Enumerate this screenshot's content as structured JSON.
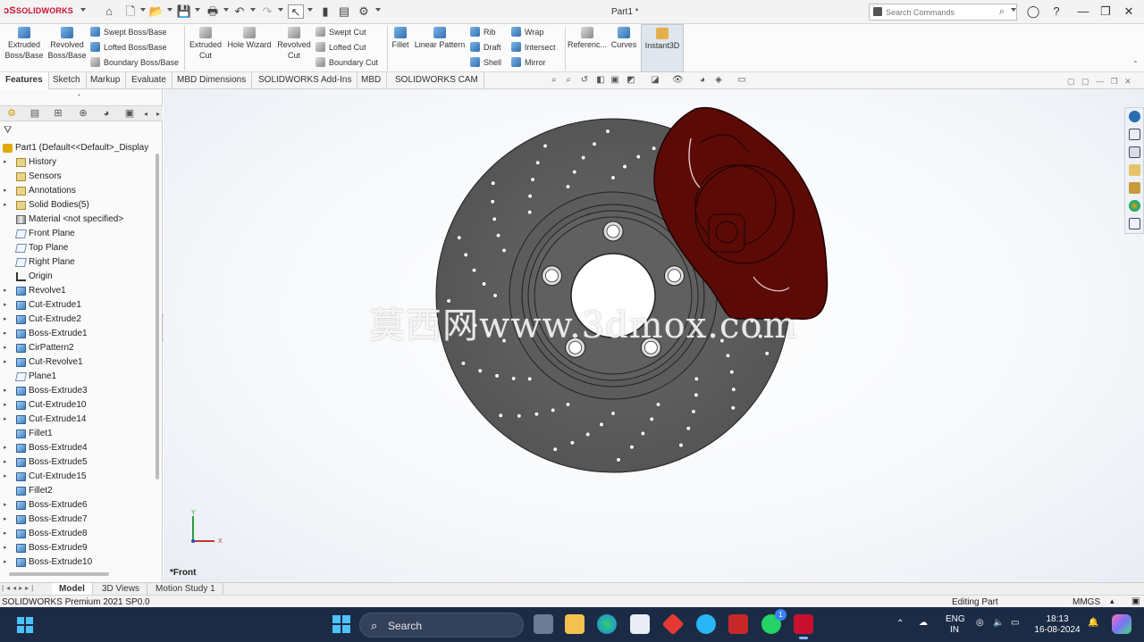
{
  "app": {
    "logo_text": "SOLIDWORKS",
    "document_title": "Part1 *",
    "search_placeholder": "Search Commands"
  },
  "ribbon": {
    "extruded_boss": "Extruded Boss/Base",
    "revolved_boss": "Revolved Boss/Base",
    "swept_boss": "Swept Boss/Base",
    "lofted_boss": "Lofted Boss/Base",
    "boundary_boss": "Boundary Boss/Base",
    "extruded_cut": "Extruded Cut",
    "hole_wizard": "Hole Wizard",
    "revolved_cut": "Revolved Cut",
    "swept_cut": "Swept Cut",
    "lofted_cut": "Lofted Cut",
    "boundary_cut": "Boundary Cut",
    "fillet": "Fillet",
    "linear_pattern": "Linear Pattern",
    "rib": "Rib",
    "draft": "Draft",
    "shell": "Shell",
    "wrap": "Wrap",
    "intersect": "Intersect",
    "mirror": "Mirror",
    "reference": "Referenc...",
    "curves": "Curves",
    "instant3d": "Instant3D"
  },
  "tabs": [
    "Features",
    "Sketch",
    "Markup",
    "Evaluate",
    "MBD Dimensions",
    "SOLIDWORKS Add-Ins",
    "MBD",
    "SOLIDWORKS CAM"
  ],
  "tree": {
    "root": "Part1  (Default<<Default>_Display",
    "items": [
      {
        "label": "History",
        "icon": "folder",
        "expand": true
      },
      {
        "label": "Sensors",
        "icon": "folder",
        "expand": false
      },
      {
        "label": "Annotations",
        "icon": "folder",
        "expand": true
      },
      {
        "label": "Solid Bodies(5)",
        "icon": "folder",
        "expand": true
      },
      {
        "label": "Material <not specified>",
        "icon": "material",
        "expand": false
      },
      {
        "label": "Front Plane",
        "icon": "plane",
        "expand": false
      },
      {
        "label": "Top Plane",
        "icon": "plane",
        "expand": false
      },
      {
        "label": "Right Plane",
        "icon": "plane",
        "expand": false
      },
      {
        "label": "Origin",
        "icon": "origin",
        "expand": false
      },
      {
        "label": "Revolve1",
        "icon": "feature",
        "expand": true
      },
      {
        "label": "Cut-Extrude1",
        "icon": "feature",
        "expand": true
      },
      {
        "label": "Cut-Extrude2",
        "icon": "feature",
        "expand": true
      },
      {
        "label": "Boss-Extrude1",
        "icon": "feature",
        "expand": true
      },
      {
        "label": "CirPattern2",
        "icon": "pattern",
        "expand": true
      },
      {
        "label": "Cut-Revolve1",
        "icon": "feature",
        "expand": true
      },
      {
        "label": "Plane1",
        "icon": "plane",
        "expand": false
      },
      {
        "label": "Boss-Extrude3",
        "icon": "feature",
        "expand": true
      },
      {
        "label": "Cut-Extrude10",
        "icon": "feature",
        "expand": true
      },
      {
        "label": "Cut-Extrude14",
        "icon": "feature",
        "expand": true
      },
      {
        "label": "Fillet1",
        "icon": "feature",
        "expand": false
      },
      {
        "label": "Boss-Extrude4",
        "icon": "feature",
        "expand": true
      },
      {
        "label": "Boss-Extrude5",
        "icon": "feature",
        "expand": true
      },
      {
        "label": "Cut-Extrude15",
        "icon": "feature",
        "expand": true
      },
      {
        "label": "Fillet2",
        "icon": "feature",
        "expand": false
      },
      {
        "label": "Boss-Extrude6",
        "icon": "feature",
        "expand": true
      },
      {
        "label": "Boss-Extrude7",
        "icon": "feature",
        "expand": true
      },
      {
        "label": "Boss-Extrude8",
        "icon": "feature",
        "expand": true
      },
      {
        "label": "Boss-Extrude9",
        "icon": "feature",
        "expand": true
      },
      {
        "label": "Boss-Extrude10",
        "icon": "feature",
        "expand": true
      }
    ]
  },
  "viewport": {
    "view_label": "*Front",
    "watermark": "莫西网www.3dmox.com",
    "triad_x": "X",
    "triad_y": "Y"
  },
  "bottom_tabs": [
    "Model",
    "3D Views",
    "Motion Study 1"
  ],
  "status": {
    "product": "SOLIDWORKS Premium 2021 SP0.0",
    "mode": "Editing Part",
    "units": "MMGS"
  },
  "taskbar": {
    "search_label": "Search",
    "lang_line1": "ENG",
    "lang_line2": "IN",
    "time": "18:13",
    "date": "16-08-2024",
    "whatsapp_badge": "1"
  },
  "colors": {
    "disc": "#5a5a5a",
    "caliper": "#5b0a06",
    "accent": "#c8102e",
    "taskbar": "#1c2b45"
  }
}
